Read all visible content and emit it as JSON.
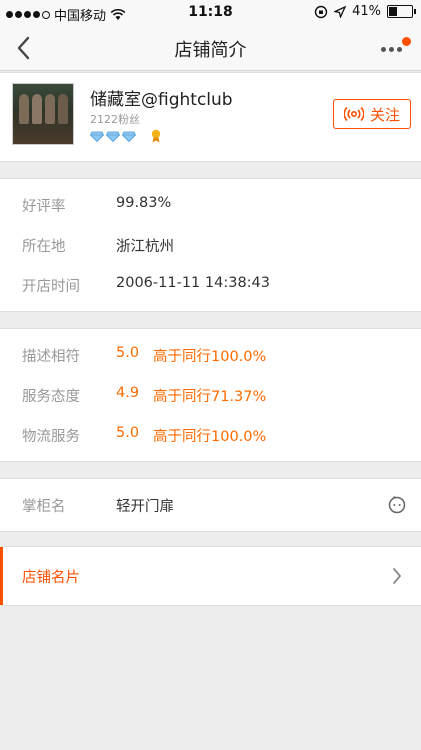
{
  "status_bar": {
    "carrier": "中国移动",
    "time": "11:18",
    "battery": "41%",
    "signal_bars_filled": 4,
    "battery_level": 0.41
  },
  "nav": {
    "title": "店铺简介",
    "back_icon": "chevron-left-icon",
    "more_icon": "more-dots-icon"
  },
  "shop": {
    "name": "储藏室@fightclub",
    "fans": "2122粉丝",
    "diamond_count": 3,
    "follow_label": "关注"
  },
  "info": {
    "rows": [
      {
        "label": "好评率",
        "value": "99.83%"
      },
      {
        "label": "所在地",
        "value": "浙江杭州"
      },
      {
        "label": "开店时间",
        "value": "2006-11-11 14:38:43"
      }
    ]
  },
  "scores": {
    "rows": [
      {
        "label": "描述相符",
        "score": "5.0",
        "compare": "高于同行100.0%"
      },
      {
        "label": "服务态度",
        "score": "4.9",
        "compare": "高于同行71.37%"
      },
      {
        "label": "物流服务",
        "score": "5.0",
        "compare": "高于同行100.0%"
      }
    ]
  },
  "keeper": {
    "label": "掌柜名",
    "value": "轻开门扉"
  },
  "card": {
    "label": "店铺名片"
  },
  "colors": {
    "accent": "#ff5000",
    "score": "#ff6a00",
    "diamond": "#6fb6ec"
  }
}
